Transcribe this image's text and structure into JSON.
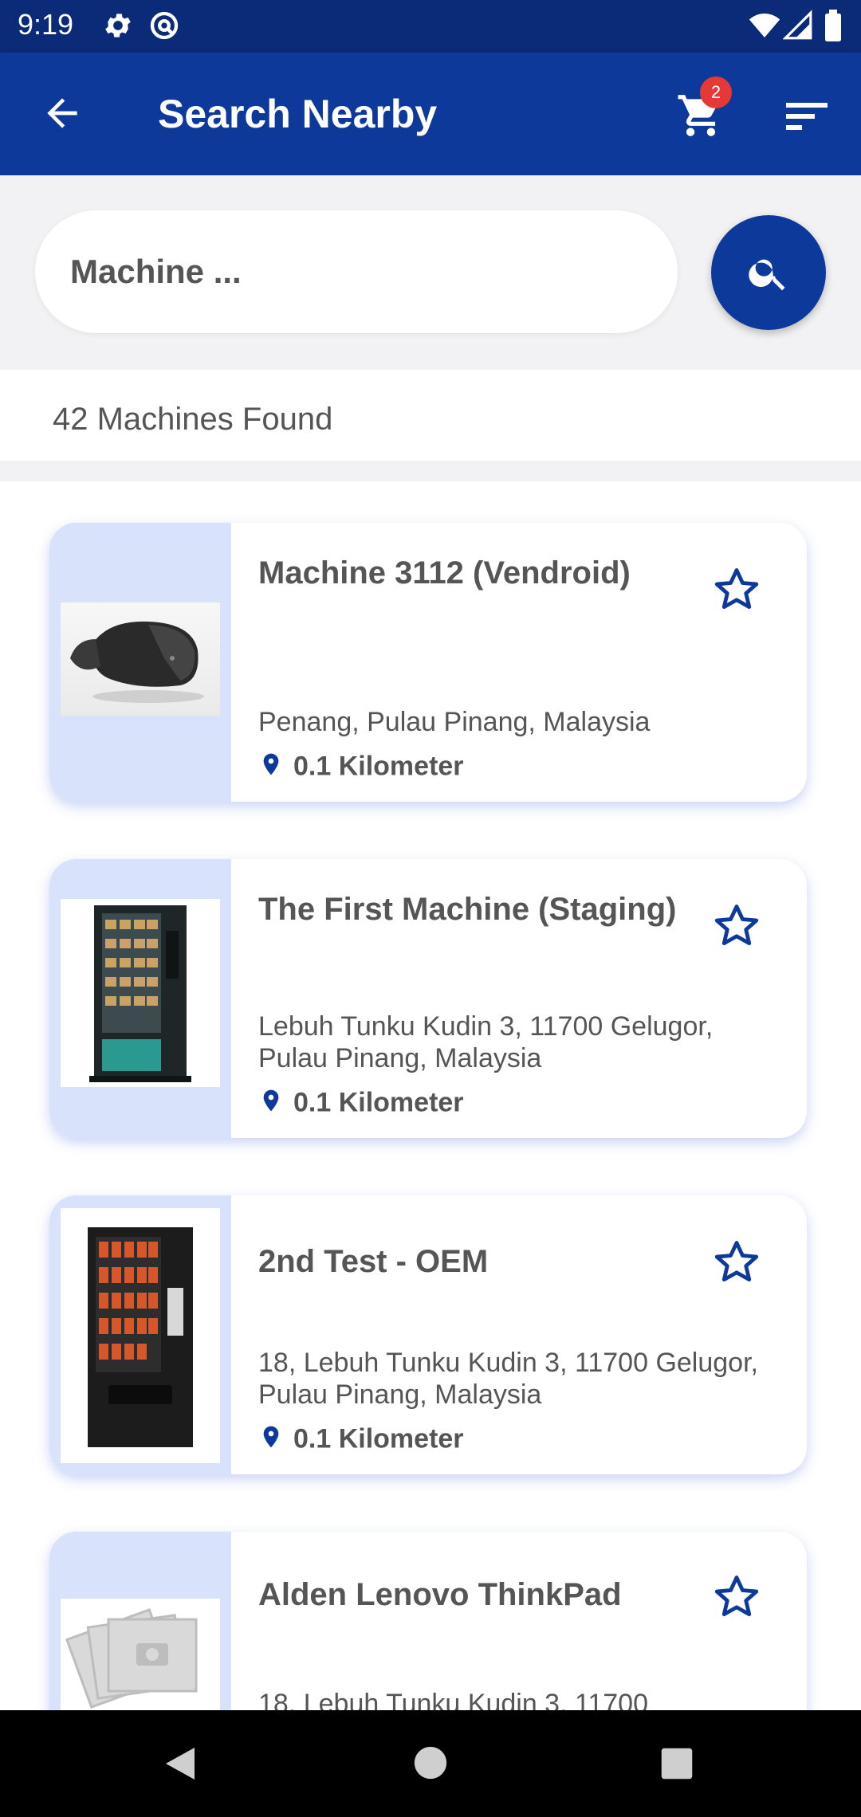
{
  "status_bar": {
    "time": "9:19"
  },
  "app_bar": {
    "title": "Search Nearby",
    "cart_count": "2"
  },
  "search": {
    "placeholder": "Machine ..."
  },
  "results": {
    "count_text": "42 Machines Found"
  },
  "machines": [
    {
      "name": "Machine 3112 (Vendroid)",
      "address": "Penang, Pulau Pinang, Malaysia",
      "distance": "0.1 Kilometer",
      "image": "vr-headset"
    },
    {
      "name": "The First Machine (Staging)",
      "address": "Lebuh Tunku Kudin 3, 11700 Gelugor, Pulau Pinang, Malaysia",
      "distance": "0.1 Kilometer",
      "image": "vending-machine-glass"
    },
    {
      "name": "2nd Test - OEM",
      "address": "18, Lebuh Tunku Kudin 3, 11700 Gelugor, Pulau Pinang, Malaysia",
      "distance": "0.1 Kilometer",
      "image": "snack-vending-machine"
    },
    {
      "name": "Alden Lenovo ThinkPad",
      "address": "18, Lebuh Tunku Kudin 3, 11700",
      "distance": "",
      "image": "no-image-placeholder"
    }
  ],
  "colors": {
    "primary": "#0d3a9a",
    "status_bar": "#0b2a78",
    "badge": "#e53935",
    "thumb_bg": "#d8e2fb"
  }
}
